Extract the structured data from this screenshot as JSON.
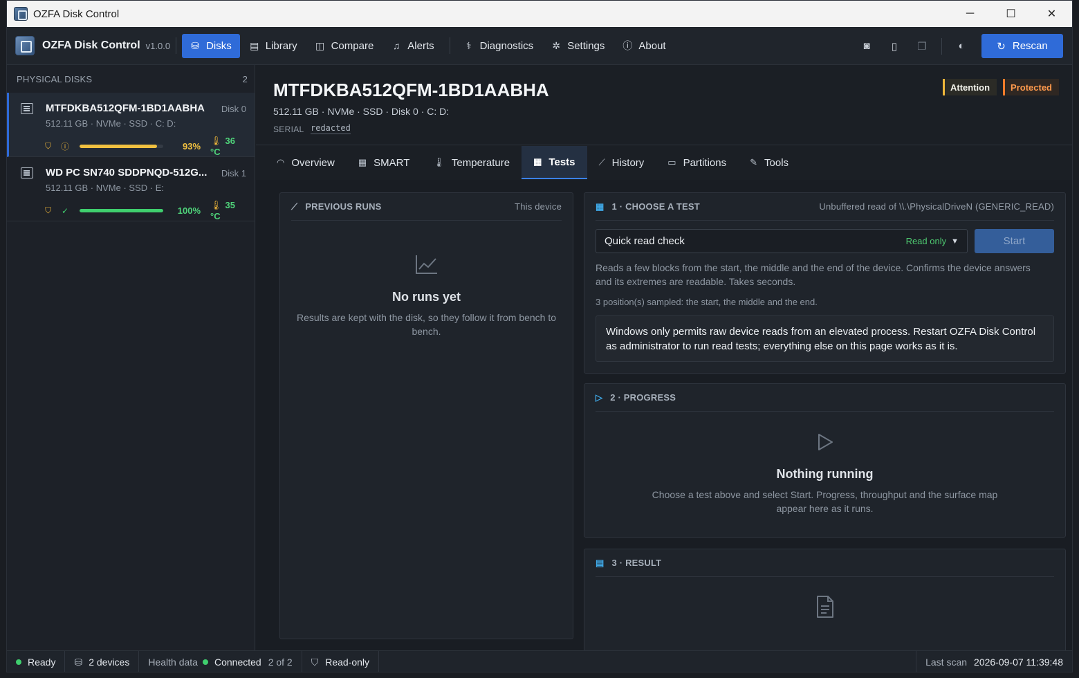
{
  "window": {
    "title": "OZFA Disk Control",
    "controls": [
      "─",
      "☐",
      "✕"
    ]
  },
  "toolbar": {
    "brand": "OZFA Disk Control",
    "version": "v1.0.0",
    "nav": [
      {
        "label": "Disks",
        "icon": "database-icon",
        "glyph": "⛁",
        "active": true
      },
      {
        "label": "Library",
        "icon": "archive-icon",
        "glyph": "▤"
      },
      {
        "label": "Compare",
        "icon": "columns-icon",
        "glyph": "◫"
      },
      {
        "label": "Alerts",
        "icon": "bell-icon",
        "glyph": "♫"
      },
      {
        "label": "Diagnostics",
        "icon": "stethoscope-icon",
        "glyph": "⚕"
      },
      {
        "label": "Settings",
        "icon": "gear-icon",
        "glyph": "✲"
      },
      {
        "label": "About",
        "icon": "info-icon",
        "glyph": "ⓘ"
      }
    ],
    "tools": [
      {
        "icon": "camera-icon",
        "glyph": "◙"
      },
      {
        "icon": "report-icon",
        "glyph": "▯"
      },
      {
        "icon": "copy-icon",
        "glyph": "❐"
      },
      {
        "icon": "contrast-icon",
        "glyph": "◐"
      }
    ],
    "rescan": {
      "label": "Rescan",
      "glyph": "↻"
    }
  },
  "sidebar": {
    "title": "PHYSICAL DISKS",
    "count": "2",
    "disks": [
      {
        "name": "MTFDKBA512QFM-1BD1AABHA",
        "index": "Disk 0",
        "meta": "512.11 GB  ·  NVMe  ·  SSD  ·  C: D:",
        "health_pct": 0.93,
        "health_label": "93%",
        "temp": "36 °C",
        "status_glyph": "ⓘ",
        "status_color": "#f0b73a",
        "bar_color": "#f0c040",
        "pct_color": "#f0c040",
        "selected": true
      },
      {
        "name": "WD PC SN740 SDDPNQD-512G...",
        "index": "Disk 1",
        "meta": "512.11 GB  ·  NVMe  ·  SSD  ·  E:",
        "health_pct": 1.0,
        "health_label": "100%",
        "temp": "35 °C",
        "status_glyph": "✓",
        "status_color": "#3fcf6e",
        "bar_color": "#3fcf6e",
        "pct_color": "#4fd37a",
        "selected": false
      }
    ]
  },
  "disk": {
    "title": "MTFDKBA512QFM-1BD1AABHA",
    "sub": "512.11 GB  ·  NVMe · SSD  ·  Disk 0  ·  C: D:",
    "serial_label": "SERIAL",
    "serial": "redacted",
    "badges": [
      "Attention",
      "Protected"
    ]
  },
  "tabs": [
    {
      "label": "Overview",
      "icon": "gauge-icon",
      "glyph": "◠"
    },
    {
      "label": "SMART",
      "icon": "table-icon",
      "glyph": "▦"
    },
    {
      "label": "Temperature",
      "icon": "thermometer-icon",
      "glyph": "🌡"
    },
    {
      "label": "Tests",
      "icon": "grid-icon",
      "glyph": "▦",
      "active": true
    },
    {
      "label": "History",
      "icon": "chart-icon",
      "glyph": "⟋"
    },
    {
      "label": "Partitions",
      "icon": "partition-icon",
      "glyph": "▭"
    },
    {
      "label": "Tools",
      "icon": "wrench-icon",
      "glyph": "✎"
    }
  ],
  "previous_runs": {
    "title": "PREVIOUS RUNS",
    "scope": "This device",
    "empty_title": "No runs yet",
    "empty_text": "Results are kept with the disk, so they follow it from bench to bench."
  },
  "choose_test": {
    "title": "1 · CHOOSE A TEST",
    "hint": "Unbuffered read of \\\\.\\PhysicalDriveN (GENERIC_READ)",
    "selected_test": "Quick read check",
    "mode": "Read only",
    "start_label": "Start",
    "description": "Reads a few blocks from the start, the middle and the end of the device. Confirms the device answers and its extremes are readable. Takes seconds.",
    "sampled": "3 position(s) sampled: the start, the middle and the end.",
    "notice": "Windows only permits raw device reads from an elevated process. Restart OZFA Disk Control as administrator to run read tests; everything else on this page works as it is."
  },
  "progress": {
    "title": "2 · PROGRESS",
    "empty_title": "Nothing running",
    "empty_text": "Choose a test above and select Start. Progress, throughput and the surface map appear here as it runs."
  },
  "result": {
    "title": "3 · RESULT"
  },
  "statusbar": {
    "ready": "Ready",
    "devices": "2 devices",
    "health_label": "Health data",
    "health_status": "Connected",
    "health_count": "2 of 2",
    "mode": "Read-only",
    "last_scan_label": "Last scan",
    "last_scan": "2026-09-07 11:39:48"
  }
}
